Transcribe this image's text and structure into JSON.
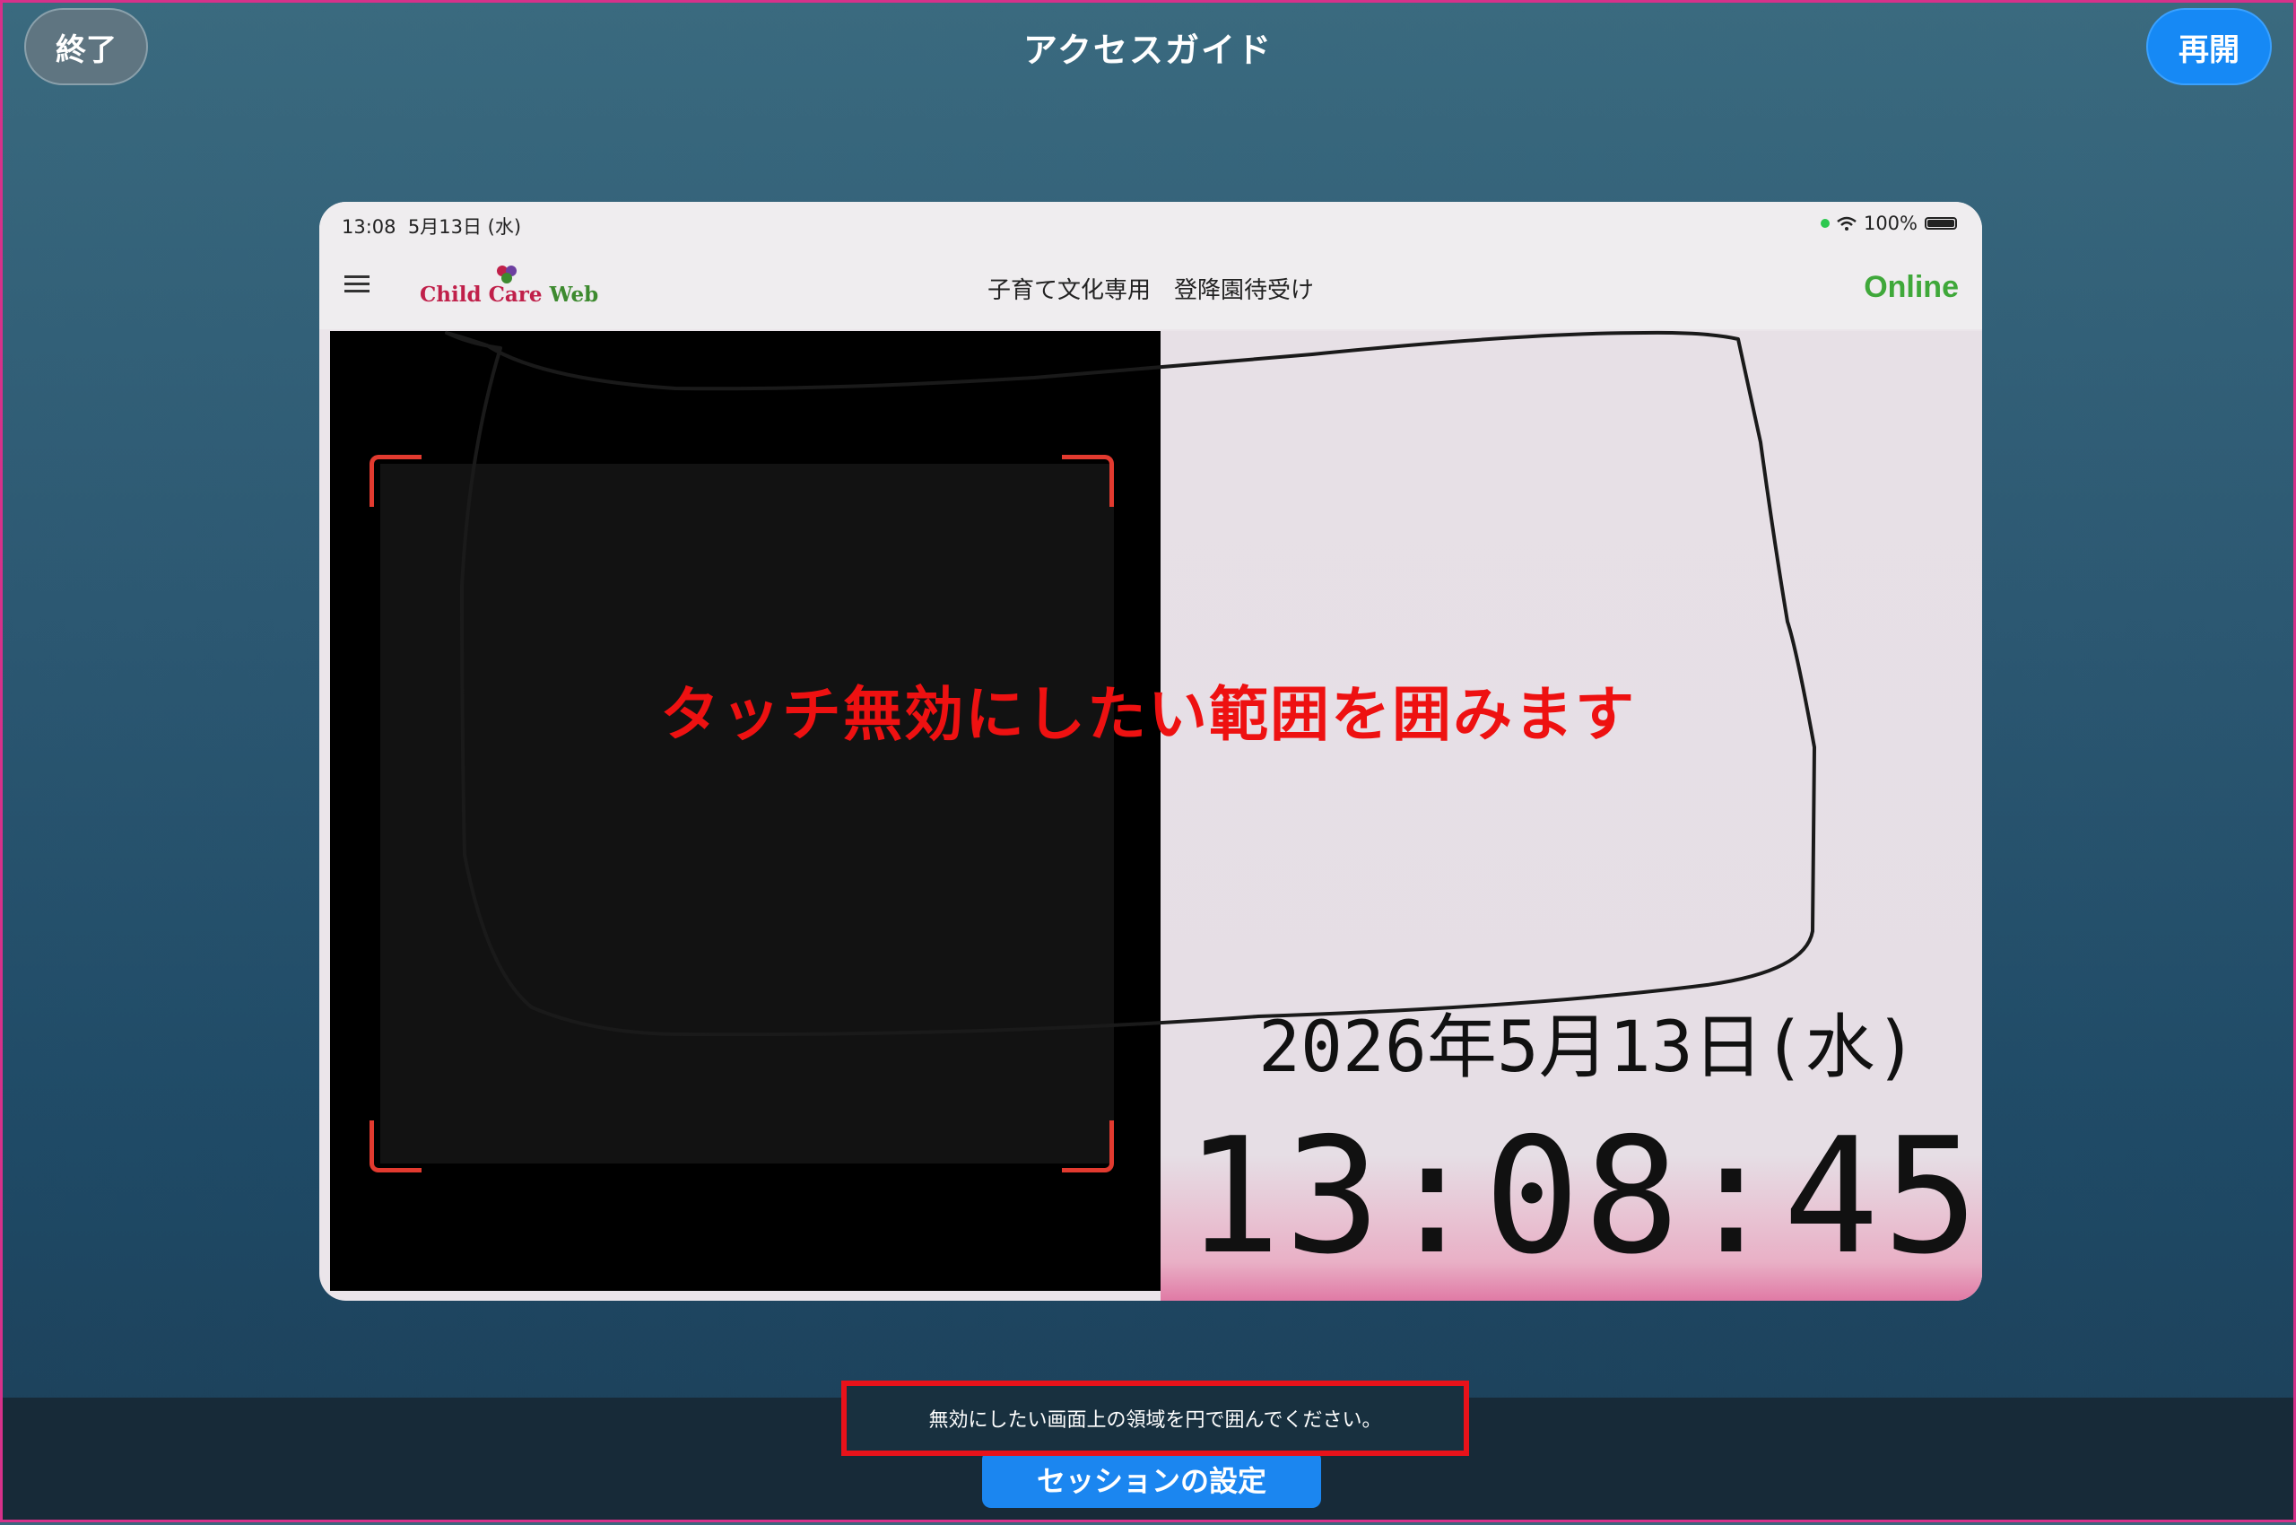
{
  "guided_access": {
    "title": "アクセスガイド",
    "end_label": "終了",
    "resume_label": "再開",
    "hint": "無効にしたい画面上の領域を円で囲んでください。",
    "session_settings_label": "セッションの設定"
  },
  "annotation": {
    "instruction": "タッチ無効にしたい範囲を囲みます"
  },
  "ipad": {
    "status": {
      "time": "13:08",
      "date": "5月13日 (水)",
      "battery": "100%"
    },
    "app": {
      "logo_part1": "Child Care ",
      "logo_part2": "Web",
      "title": "子育て文化専用　登降園待受け",
      "connection": "Online"
    },
    "display": {
      "date": "2026年5月13日(水)",
      "clock": "13:08:45"
    }
  },
  "colors": {
    "accent_blue": "#1b86f0",
    "online_green": "#3fa83a",
    "annotation_red": "#ee1111",
    "scanner_corner": "#e23a2f"
  }
}
